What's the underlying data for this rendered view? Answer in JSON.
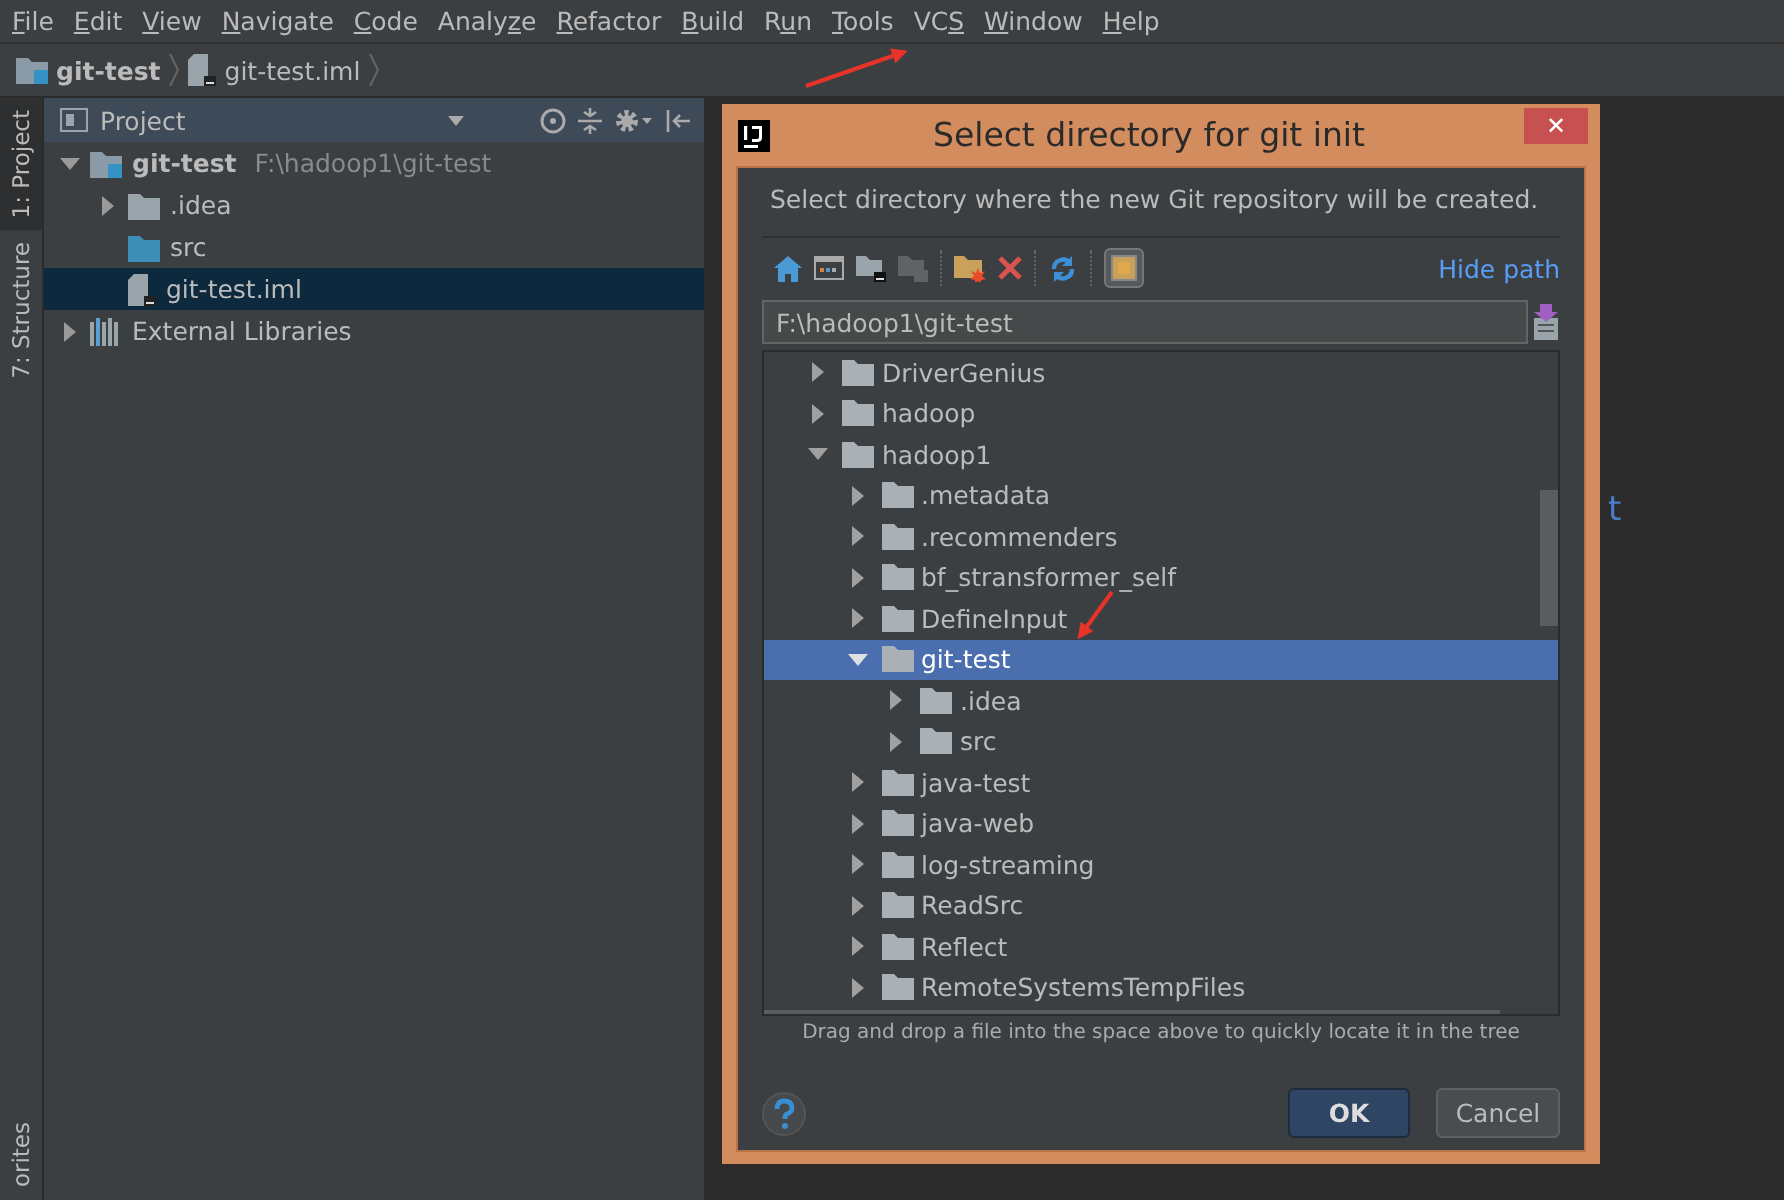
{
  "menu": [
    {
      "key": "F",
      "post": "ile"
    },
    {
      "key": "E",
      "post": "dit"
    },
    {
      "key": "V",
      "post": "iew"
    },
    {
      "key": "N",
      "post": "avigate"
    },
    {
      "key": "C",
      "post": "ode"
    },
    {
      "pre": "Analy",
      "key": "z",
      "post": "e"
    },
    {
      "key": "R",
      "post": "efactor"
    },
    {
      "key": "B",
      "post": "uild"
    },
    {
      "pre": "R",
      "key": "u",
      "post": "n"
    },
    {
      "key": "T",
      "post": "ools"
    },
    {
      "pre": "VC",
      "key": "S"
    },
    {
      "key": "W",
      "post": "indow"
    },
    {
      "key": "H",
      "post": "elp"
    }
  ],
  "breadcrumb": [
    {
      "label": "git-test",
      "kind": "module"
    },
    {
      "label": "git-test.iml",
      "kind": "file"
    }
  ],
  "side_tabs": [
    {
      "label": "1: Project",
      "selected": true
    },
    {
      "label": "7: Structure",
      "selected": false
    },
    {
      "label": "orites",
      "selected": false
    }
  ],
  "project": {
    "title": "Project",
    "tree": [
      {
        "label": "git-test",
        "path": "F:\\hadoop1\\git-test",
        "kind": "module",
        "expanded": true,
        "selected": false,
        "children": [
          {
            "label": ".idea",
            "kind": "folder",
            "expanded": false,
            "selected": false
          },
          {
            "label": "src",
            "kind": "source",
            "selected": false
          },
          {
            "label": "git-test.iml",
            "kind": "file",
            "selected": true
          }
        ]
      },
      {
        "label": "External Libraries",
        "kind": "library",
        "expanded": false,
        "selected": false
      }
    ]
  },
  "editor": {
    "text": "t"
  },
  "dialog": {
    "title": "Select directory for git init",
    "close": "✕",
    "description": "Select directory where the new Git repository will be created.",
    "hide_path": "Hide path",
    "path": "F:\\hadoop1\\git-test",
    "tree": [
      {
        "label": "DriverGenius",
        "expanded": false,
        "selected": false
      },
      {
        "label": "hadoop",
        "expanded": false,
        "selected": false
      },
      {
        "label": "hadoop1",
        "expanded": true,
        "selected": false,
        "children": [
          {
            "label": ".metadata",
            "expanded": false,
            "selected": false
          },
          {
            "label": ".recommenders",
            "expanded": false,
            "selected": false
          },
          {
            "label": "bf_stransformer_self",
            "expanded": false,
            "selected": false
          },
          {
            "label": "DefineInput",
            "expanded": false,
            "selected": false
          },
          {
            "label": "git-test",
            "expanded": true,
            "selected": true,
            "children": [
              {
                "label": ".idea",
                "expanded": false,
                "selected": false
              },
              {
                "label": "src",
                "expanded": false,
                "selected": false
              }
            ]
          },
          {
            "label": "java-test",
            "expanded": false,
            "selected": false
          },
          {
            "label": "java-web",
            "expanded": false,
            "selected": false
          },
          {
            "label": "log-streaming",
            "expanded": false,
            "selected": false
          },
          {
            "label": "ReadSrc",
            "expanded": false,
            "selected": false
          },
          {
            "label": "Reflect",
            "expanded": false,
            "selected": false
          },
          {
            "label": "RemoteSystemsTempFiles",
            "expanded": false,
            "selected": false
          }
        ]
      }
    ],
    "hint": "Drag and drop a file into the space above to quickly locate it in the tree",
    "buttons": [
      {
        "label": "OK",
        "kind": "default"
      },
      {
        "label": "Cancel",
        "kind": "normal"
      }
    ]
  }
}
